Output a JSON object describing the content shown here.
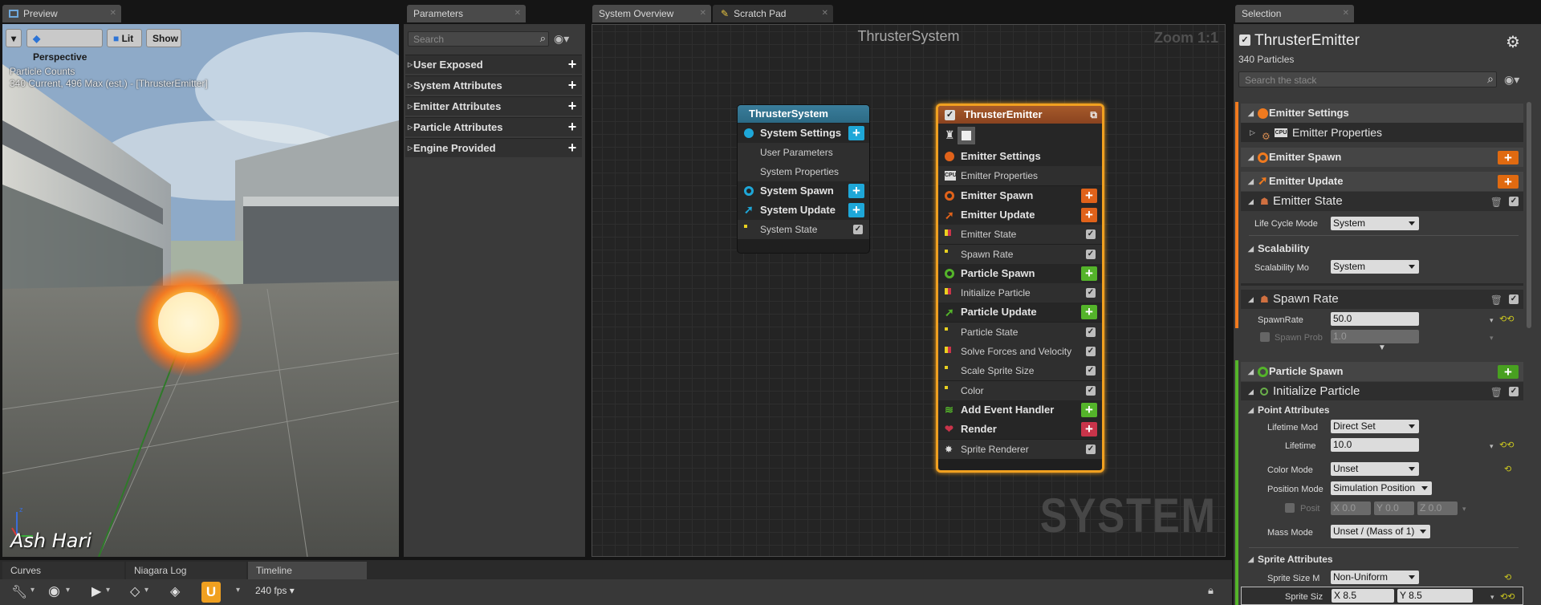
{
  "tabs": {
    "preview": "Preview",
    "parameters": "Parameters",
    "system_overview": "System Overview",
    "scratch_pad": "Scratch Pad",
    "selection": "Selection",
    "curves": "Curves",
    "niagara_log": "Niagara Log",
    "timeline": "Timeline"
  },
  "viewport": {
    "perspective": "Perspective",
    "lit": "Lit",
    "show": "Show",
    "stats_title": "Particle Counts",
    "stats_value": "340 Current, 496 Max (est.) - [ThrusterEmitter]",
    "watermark": "Ash Hari"
  },
  "parameters": {
    "search_placeholder": "Search",
    "categories": [
      "User Exposed",
      "System Attributes",
      "Emitter Attributes",
      "Particle Attributes",
      "Engine Provided"
    ]
  },
  "graph": {
    "title": "ThrusterSystem",
    "zoom": "Zoom 1:1",
    "watermark": "SYSTEM",
    "system_node": {
      "title": "ThrusterSystem",
      "rows": [
        "System Settings",
        "User Parameters",
        "System Properties",
        "System Spawn",
        "System Update",
        "System State"
      ]
    },
    "emitter_node": {
      "title": "ThrusterEmitter",
      "rows": [
        "Emitter Settings",
        "Emitter Properties",
        "Emitter Spawn",
        "Emitter Update",
        "Emitter State",
        "Spawn Rate",
        "Particle Spawn",
        "Initialize Particle",
        "Particle Update",
        "Particle State",
        "Solve Forces and Velocity",
        "Scale Sprite Size",
        "Color",
        "Add Event Handler",
        "Render",
        "Sprite Renderer"
      ]
    }
  },
  "selection": {
    "title": "ThrusterEmitter",
    "count": "340 Particles",
    "search_placeholder": "Search the stack",
    "rows": {
      "emitter_settings": "Emitter Settings",
      "emitter_properties": "Emitter Properties",
      "emitter_spawn": "Emitter Spawn",
      "emitter_update": "Emitter Update",
      "emitter_state": "Emitter State",
      "life_cycle_label": "Life Cycle Mode",
      "life_cycle_value": "System",
      "scalability": "Scalability",
      "scalability_label": "Scalability Mo",
      "scalability_value": "System",
      "spawn_rate": "Spawn Rate",
      "spawnrate_label": "SpawnRate",
      "spawnrate_value": "50.0",
      "spawn_prob_label": "Spawn Prob",
      "spawn_prob_value": "1.0",
      "particle_spawn": "Particle Spawn",
      "initialize_particle": "Initialize Particle",
      "point_attributes": "Point Attributes",
      "lifetime_mode_label": "Lifetime Mod",
      "lifetime_mode_value": "Direct Set",
      "lifetime_label": "Lifetime",
      "lifetime_value": "10.0",
      "color_mode_label": "Color Mode",
      "color_mode_value": "Unset",
      "position_mode_label": "Position Mode",
      "position_mode_value": "Simulation Position",
      "position_label": "Posit",
      "pos_x": "X 0.0",
      "pos_y": "Y 0.0",
      "pos_z": "Z 0.0",
      "mass_mode_label": "Mass Mode",
      "mass_mode_value": "Unset / (Mass of 1)",
      "sprite_attributes": "Sprite Attributes",
      "sprite_size_mode_label": "Sprite Size M",
      "sprite_size_mode_value": "Non-Uniform",
      "sprite_size_label": "Sprite Siz",
      "sprite_x": "X 8.5",
      "sprite_y": "Y 8.5"
    }
  },
  "timeline": {
    "fps": "240 fps"
  },
  "colors": {
    "orange": "#f07a1f",
    "green": "#54b42a",
    "blue": "#1ea7d8",
    "red": "#c9344a",
    "node_teal": "#2c6a85"
  }
}
